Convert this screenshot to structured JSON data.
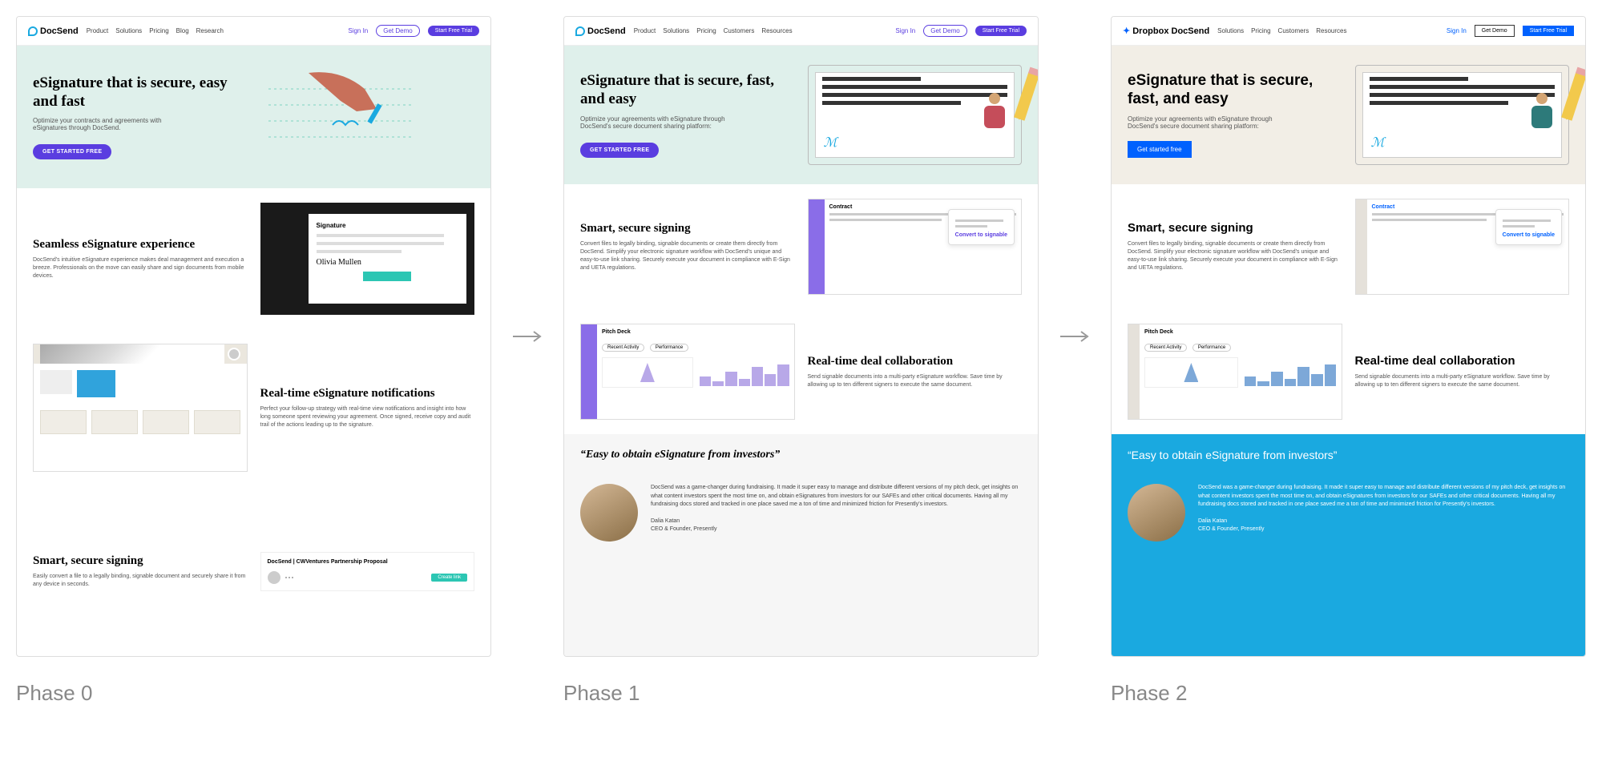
{
  "phase0": {
    "label": "Phase 0",
    "nav": {
      "brand": "DocSend",
      "links": [
        "Product",
        "Solutions",
        "Pricing",
        "Blog",
        "Research"
      ],
      "signin": "Sign In",
      "demo": "Get Demo",
      "trial": "Start Free Trial"
    },
    "hero": {
      "h": "eSignature that is secure, easy and fast",
      "p": "Optimize your contracts and agreements with eSignatures through DocSend.",
      "cta": "GET STARTED FREE"
    },
    "sec1": {
      "h": "Seamless eSignature experience",
      "p": "DocSend's intuitive eSignature experience makes deal management and execution a breeze. Professionals on the move can easily share and sign documents from mobile devices."
    },
    "sec2": {
      "h": "Real-time eSignature notifications",
      "p": "Perfect your follow-up strategy with real-time view notifications and insight into how long someone spent reviewing your agreement. Once signed, receive copy and audit trail of the actions leading up to the signature."
    },
    "sec3": {
      "h": "Smart, secure signing",
      "p": "Easily convert a file to a legally binding, signable document and securely share it from any device in seconds."
    },
    "footer_doc": "DocSend | CWVentures Partnership Proposal",
    "footer_btn": "Create link"
  },
  "phase1": {
    "label": "Phase 1",
    "nav": {
      "brand": "DocSend",
      "links": [
        "Product",
        "Solutions",
        "Pricing",
        "Customers",
        "Resources"
      ],
      "signin": "Sign In",
      "demo": "Get Demo",
      "trial": "Start Free Trial"
    },
    "hero": {
      "h": "eSignature that is secure, fast, and easy",
      "p": "Optimize your agreements with eSignature through DocSend's secure document sharing platform:",
      "cta": "GET STARTED FREE"
    },
    "sec1": {
      "h": "Smart, secure signing",
      "p": "Convert files to legally binding, signable documents or create them directly from DocSend. Simplify your electronic signature workflow with DocSend's unique and easy-to-use link sharing. Securely execute your document in compliance with E-Sign and UETA regulations.",
      "convert": "Convert to signable",
      "contract": "Contract"
    },
    "sec2": {
      "h": "Real-time deal collaboration",
      "p": "Send signable documents into a multi-party eSignature workflow. Save time by allowing up to ten different signers to execute the same document.",
      "pitch": "Pitch Deck",
      "tabs": [
        "Recent Activity",
        "Performance"
      ]
    },
    "quote": {
      "h": "“Easy to obtain eSignature from investors”",
      "body": "DocSend was a game-changer during fundraising. It made it super easy to manage and distribute different versions of my pitch deck, get insights on what content investors spent the most time on, and obtain eSignatures from investors for our SAFEs and other critical documents. Having all my fundraising docs stored and tracked in one place saved me a ton of time and minimized friction for Presently's investors.",
      "author": "Dalia Katan",
      "role": "CEO & Founder, Presently"
    }
  },
  "phase2": {
    "label": "Phase 2",
    "nav": {
      "brand": "Dropbox DocSend",
      "links": [
        "Solutions",
        "Pricing",
        "Customers",
        "Resources"
      ],
      "signin": "Sign In",
      "demo": "Get Demo",
      "trial": "Start Free Trial"
    },
    "hero": {
      "h": "eSignature that is secure, fast, and easy",
      "p": "Optimize your agreements with eSignature through DocSend's secure document sharing platform:",
      "cta": "Get started free"
    },
    "sec1": {
      "h": "Smart, secure signing",
      "p": "Convert files to legally binding, signable documents or create them directly from DocSend. Simplify your electronic signature workflow with DocSend's unique and easy-to-use link sharing. Securely execute your document in compliance with E-Sign and UETA regulations.",
      "convert": "Convert to signable",
      "contract": "Contract"
    },
    "sec2": {
      "h": "Real-time deal collaboration",
      "p": "Send signable documents into a multi-party eSignature workflow. Save time by allowing up to ten different signers to execute the same document.",
      "pitch": "Pitch Deck",
      "tabs": [
        "Recent Activity",
        "Performance"
      ]
    },
    "quote": {
      "h": "“Easy to obtain eSignature from investors”",
      "body": "DocSend was a game-changer during fundraising. It made it super easy to manage and distribute different versions of my pitch deck, get insights on what content investors spent the most time on, and obtain eSignatures from investors for our SAFEs and other critical documents. Having all my fundraising docs stored and tracked in one place saved me a ton of time and minimized friction for Presently's investors.",
      "author": "Dalia Katan",
      "role": "CEO & Founder, Presently"
    }
  }
}
